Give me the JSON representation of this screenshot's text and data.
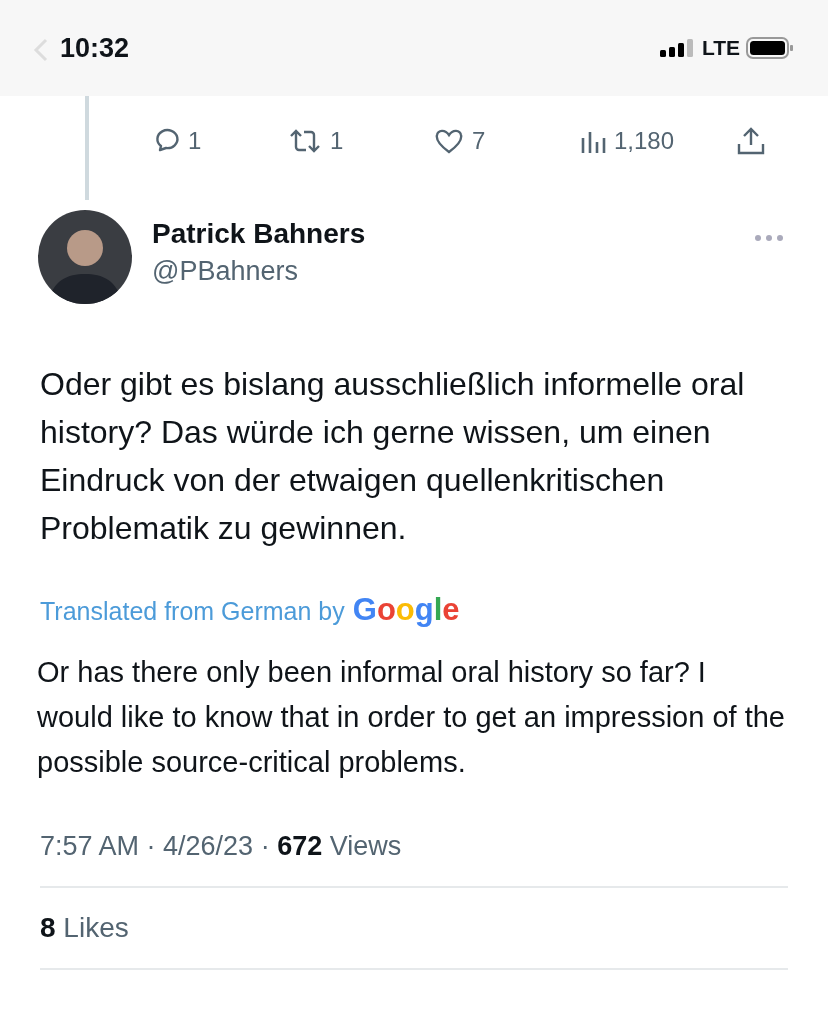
{
  "status_bar": {
    "time": "10:32",
    "network": "LTE"
  },
  "previous_tweet": {
    "actions": [
      {
        "kind": "reply",
        "count": "1"
      },
      {
        "kind": "retweet",
        "count": "1"
      },
      {
        "kind": "like",
        "count": "7"
      },
      {
        "kind": "views",
        "count": "1,180"
      },
      {
        "kind": "share"
      }
    ]
  },
  "tweet": {
    "name": "Patrick Bahners",
    "handle": "@PBahners",
    "text": "Oder gibt es bislang ausschließlich informelle oral history? Das würde ich gerne wissen, um einen Eindruck von der etwaigen quellenkritischen Problematik zu gewinnen.",
    "translation_note": "Translated from German by",
    "translator": "Google",
    "translation": "Or has there only been informal oral history so far? I would like to know that in order to get an impression of the possible source-critical problems.",
    "meta": "7:57 AM · 4/26/23 · **672** Views",
    "likes": "**8** Likes"
  }
}
